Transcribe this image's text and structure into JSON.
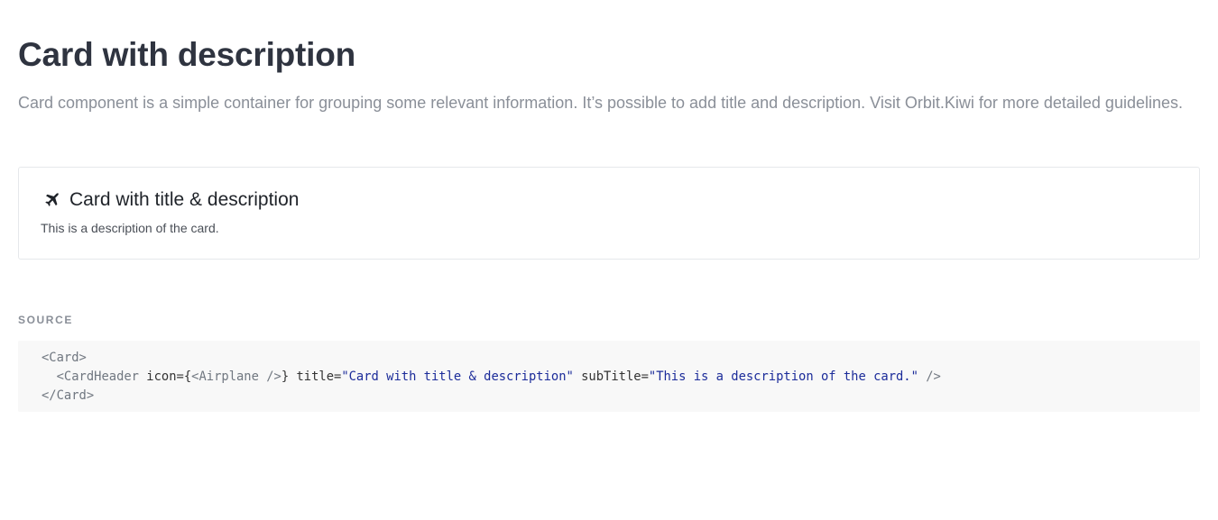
{
  "page": {
    "title": "Card with description",
    "intro": "Card component is a simple container for grouping some relevant information. It’s possible to add title and description. Visit Orbit.Kiwi for more detailed guidelines."
  },
  "card": {
    "icon": "airplane-icon",
    "title": "Card with title & description",
    "subtitle": "This is a description of the card."
  },
  "source": {
    "label": "SOURCE",
    "lines": [
      [
        {
          "t": "tag",
          "v": "<Card>"
        }
      ],
      [
        {
          "t": "tag",
          "v": "  <CardHeader "
        },
        {
          "t": "attr",
          "v": "icon="
        },
        {
          "t": "punct",
          "v": "{"
        },
        {
          "t": "tag",
          "v": "<Airplane />"
        },
        {
          "t": "punct",
          "v": "} "
        },
        {
          "t": "attr",
          "v": "title="
        },
        {
          "t": "str",
          "v": "\"Card with title & description\""
        },
        {
          "t": "attr",
          "v": " subTitle="
        },
        {
          "t": "str",
          "v": "\"This is a description of the card.\""
        },
        {
          "t": "tag",
          "v": " />"
        }
      ],
      [
        {
          "t": "tag",
          "v": "</Card>"
        }
      ]
    ]
  },
  "colors": {
    "heading": "#2f3440",
    "muted": "#8a8f98",
    "border": "#e6e8eb",
    "code_bg": "#f8f8f8",
    "code_string": "#1c2c9a",
    "code_tag": "#707780"
  }
}
